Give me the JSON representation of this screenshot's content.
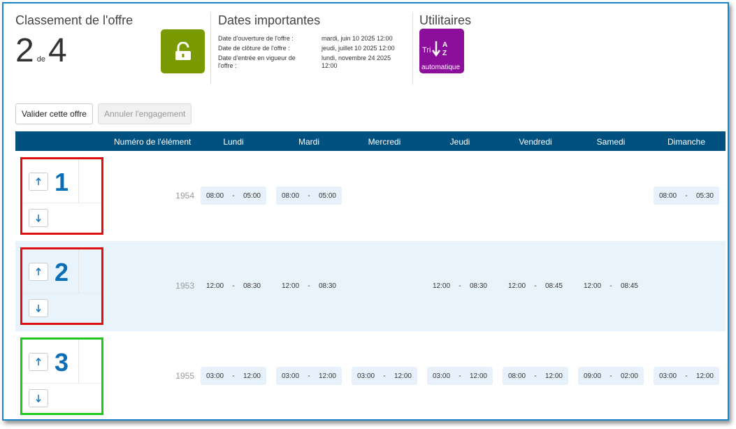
{
  "rank_section": {
    "title": "Classement de l'offre",
    "position": "2",
    "of_label": "de",
    "total": "4"
  },
  "icons": {
    "lock": "unlock-icon",
    "sort": "sort-az-icon",
    "up": "arrow-up-icon",
    "down": "arrow-down-icon"
  },
  "colors": {
    "lock_bg": "#7a9a01",
    "sort_bg": "#8c0f9c",
    "header_bg": "#005080",
    "frame": "#1a86c8",
    "rank_red": "#e01010",
    "rank_green": "#1ec81e",
    "rank_num": "#0b6fb8"
  },
  "dates": {
    "title": "Dates importantes",
    "rows": [
      {
        "label": "Date d'ouverture de l'offre :",
        "value": "mardi, juin 10 2025 12:00"
      },
      {
        "label": "Date de clôture de l'offre :",
        "value": "jeudi, juillet 10 2025 12:00"
      },
      {
        "label": "Date d'entrée en vigueur de l'offre :",
        "value": "lundi, novembre 24 2025 12:00"
      }
    ]
  },
  "utilities": {
    "title": "Utilitaires",
    "sort_prefix": "Tri",
    "sort_label": "automatique"
  },
  "actions": {
    "validate": "Valider cette offre",
    "cancel": "Annuler l'engagement"
  },
  "table": {
    "headers": {
      "element": "Numéro de l'élément",
      "days": [
        "Lundi",
        "Mardi",
        "Mercredi",
        "Jeudi",
        "Vendredi",
        "Samedi",
        "Dimanche"
      ]
    },
    "dash": "-",
    "rows": [
      {
        "rank": "1",
        "element": "1954",
        "slots": [
          {
            "start": "08:00",
            "end": "05:00"
          },
          {
            "start": "08:00",
            "end": "05:00"
          },
          {
            "start": "",
            "end": ""
          },
          {
            "start": "",
            "end": ""
          },
          {
            "start": "",
            "end": ""
          },
          {
            "start": "",
            "end": ""
          },
          {
            "start": "08:00",
            "end": "05:30"
          }
        ]
      },
      {
        "rank": "2",
        "element": "1953",
        "slots": [
          {
            "start": "12:00",
            "end": "08:30"
          },
          {
            "start": "12:00",
            "end": "08:30"
          },
          {
            "start": "",
            "end": ""
          },
          {
            "start": "12:00",
            "end": "08:30"
          },
          {
            "start": "12:00",
            "end": "08:45"
          },
          {
            "start": "12:00",
            "end": "08:45"
          },
          {
            "start": "",
            "end": ""
          }
        ]
      },
      {
        "rank": "3",
        "element": "1955",
        "slots": [
          {
            "start": "03:00",
            "end": "12:00"
          },
          {
            "start": "03:00",
            "end": "12:00"
          },
          {
            "start": "03:00",
            "end": "12:00"
          },
          {
            "start": "03:00",
            "end": "12:00"
          },
          {
            "start": "08:00",
            "end": "12:00"
          },
          {
            "start": "09:00",
            "end": "02:00"
          },
          {
            "start": "03:00",
            "end": "12:00"
          }
        ]
      }
    ]
  }
}
